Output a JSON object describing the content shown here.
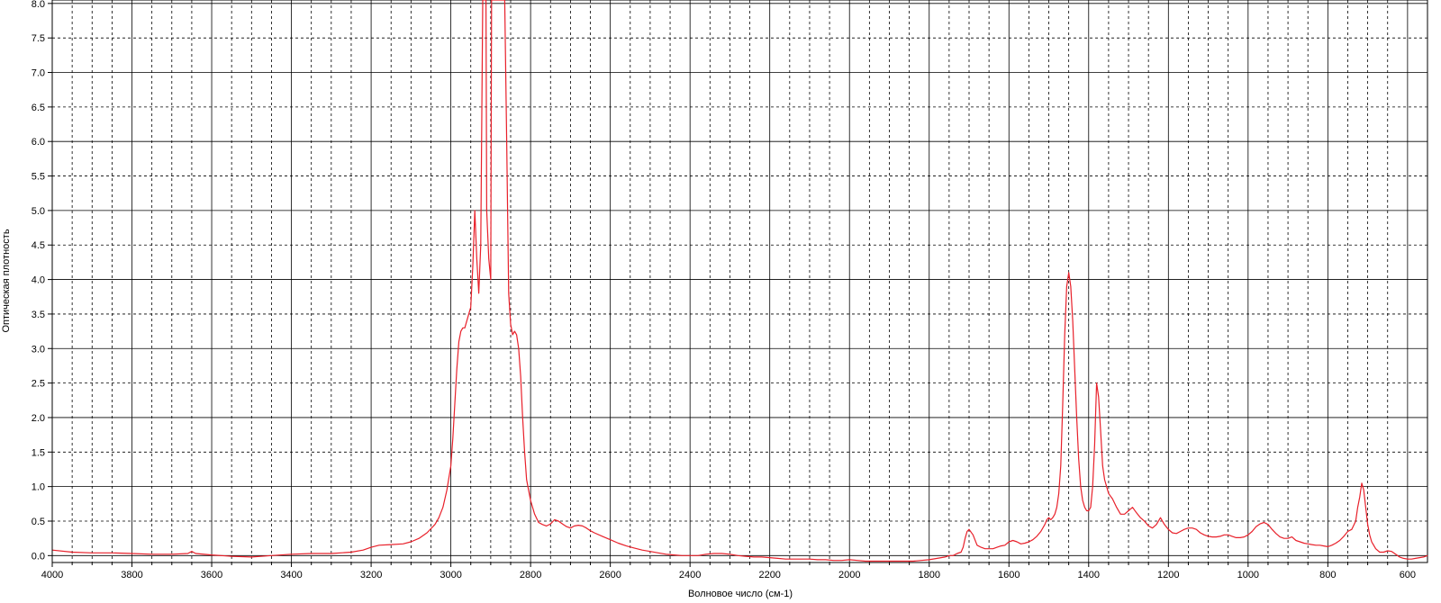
{
  "chart_data": {
    "type": "line",
    "xlabel": "Волновое число (см-1)",
    "ylabel": "Оптическая плотность",
    "xlim": [
      4000,
      550
    ],
    "ylim": [
      -0.1,
      8.05
    ],
    "x_reversed": true,
    "grid": true,
    "grid_major_x_step": 200,
    "grid_minor_x_step": 50,
    "grid_y_step": 0.5,
    "xticks": [
      4000,
      3800,
      3600,
      3400,
      3200,
      3000,
      2800,
      2600,
      2400,
      2200,
      2000,
      1800,
      1600,
      1400,
      1200,
      1000,
      800,
      600
    ],
    "xtick_labels": [
      "4000",
      "3800",
      "3600",
      "3400",
      "3200",
      "3000",
      "2800",
      "2600",
      "2400",
      "2200",
      "2000",
      "1800",
      "1600",
      "1400",
      "1200",
      "1000",
      "800",
      "600"
    ],
    "yticks": [
      0.0,
      0.5,
      1.0,
      1.5,
      2.0,
      2.5,
      3.0,
      3.5,
      4.0,
      4.5,
      5.0,
      5.5,
      6.0,
      6.5,
      7.0,
      7.5,
      8.0
    ],
    "ytick_labels": [
      "0.0",
      "0.5",
      "1.0",
      "1.5",
      "2.0",
      "2.5",
      "3.0",
      "3.5",
      "4.0",
      "4.5",
      "5.0",
      "5.5",
      "6.0",
      "6.5",
      "7.0",
      "7.5",
      "8.0"
    ],
    "colors": {
      "series": "#e8202a",
      "grid_major": "#000000",
      "grid_minor": "#000000",
      "axis": "#000000"
    },
    "series": [
      {
        "x": [
          4000,
          3950,
          3900,
          3850,
          3800,
          3750,
          3700,
          3660,
          3650,
          3640,
          3600,
          3550,
          3500,
          3450,
          3400,
          3350,
          3300,
          3250,
          3220,
          3200,
          3180,
          3150,
          3120,
          3100,
          3080,
          3060,
          3040,
          3030,
          3020,
          3010,
          3000,
          2995,
          2990,
          2985,
          2980,
          2975,
          2970,
          2965,
          2960,
          2955,
          2950,
          2945,
          2940,
          2935,
          2930,
          2925,
          2920,
          2915,
          2912,
          2910,
          2905,
          2900,
          2898,
          2895,
          2890,
          2880,
          2870,
          2865,
          2860,
          2855,
          2850,
          2845,
          2840,
          2835,
          2830,
          2825,
          2820,
          2815,
          2810,
          2800,
          2790,
          2780,
          2770,
          2760,
          2750,
          2740,
          2730,
          2720,
          2710,
          2700,
          2690,
          2680,
          2670,
          2660,
          2650,
          2640,
          2620,
          2600,
          2580,
          2560,
          2540,
          2520,
          2500,
          2480,
          2460,
          2440,
          2420,
          2400,
          2380,
          2360,
          2340,
          2320,
          2300,
          2280,
          2260,
          2240,
          2220,
          2200,
          2180,
          2160,
          2140,
          2120,
          2100,
          2080,
          2060,
          2040,
          2020,
          2000,
          1980,
          1960,
          1940,
          1920,
          1900,
          1880,
          1860,
          1840,
          1820,
          1800,
          1780,
          1760,
          1750,
          1740,
          1730,
          1720,
          1715,
          1710,
          1705,
          1700,
          1690,
          1680,
          1670,
          1660,
          1650,
          1640,
          1630,
          1620,
          1610,
          1600,
          1590,
          1580,
          1570,
          1560,
          1550,
          1540,
          1530,
          1520,
          1510,
          1505,
          1500,
          1495,
          1490,
          1485,
          1480,
          1475,
          1470,
          1465,
          1460,
          1455,
          1450,
          1445,
          1440,
          1435,
          1430,
          1425,
          1420,
          1415,
          1410,
          1405,
          1400,
          1395,
          1390,
          1385,
          1380,
          1375,
          1370,
          1365,
          1360,
          1355,
          1350,
          1340,
          1330,
          1320,
          1310,
          1300,
          1290,
          1280,
          1270,
          1260,
          1250,
          1240,
          1230,
          1220,
          1210,
          1200,
          1190,
          1180,
          1170,
          1160,
          1150,
          1140,
          1130,
          1120,
          1110,
          1100,
          1090,
          1080,
          1070,
          1060,
          1050,
          1040,
          1030,
          1020,
          1010,
          1000,
          990,
          980,
          970,
          960,
          950,
          940,
          930,
          920,
          910,
          900,
          890,
          880,
          870,
          860,
          850,
          840,
          830,
          820,
          810,
          800,
          790,
          780,
          770,
          760,
          750,
          740,
          730,
          725,
          720,
          715,
          710,
          705,
          700,
          695,
          690,
          680,
          670,
          660,
          650,
          640,
          630,
          620,
          610,
          600,
          590,
          580,
          570,
          560,
          550
        ],
        "y": [
          0.08,
          0.05,
          0.04,
          0.04,
          0.03,
          0.02,
          0.02,
          0.03,
          0.06,
          0.03,
          0.01,
          -0.01,
          -0.02,
          0.0,
          0.02,
          0.03,
          0.03,
          0.05,
          0.08,
          0.12,
          0.15,
          0.16,
          0.17,
          0.2,
          0.25,
          0.33,
          0.45,
          0.55,
          0.7,
          0.95,
          1.3,
          1.7,
          2.2,
          2.7,
          3.1,
          3.25,
          3.3,
          3.3,
          3.4,
          3.5,
          3.6,
          4.2,
          5.0,
          4.3,
          3.8,
          4.5,
          8.2,
          8.2,
          8.2,
          5.0,
          4.3,
          4.0,
          8.2,
          8.2,
          8.2,
          8.2,
          8.2,
          8.2,
          6.0,
          3.8,
          3.35,
          3.2,
          3.25,
          3.2,
          3.0,
          2.6,
          2.0,
          1.5,
          1.1,
          0.8,
          0.6,
          0.48,
          0.45,
          0.43,
          0.46,
          0.52,
          0.5,
          0.46,
          0.42,
          0.4,
          0.43,
          0.44,
          0.43,
          0.4,
          0.36,
          0.33,
          0.28,
          0.23,
          0.18,
          0.14,
          0.11,
          0.08,
          0.06,
          0.04,
          0.02,
          0.01,
          0.0,
          0.0,
          0.0,
          0.02,
          0.03,
          0.03,
          0.02,
          0.0,
          -0.01,
          -0.02,
          -0.02,
          -0.03,
          -0.04,
          -0.05,
          -0.05,
          -0.05,
          -0.05,
          -0.06,
          -0.06,
          -0.07,
          -0.07,
          -0.06,
          -0.07,
          -0.08,
          -0.08,
          -0.08,
          -0.08,
          -0.08,
          -0.08,
          -0.08,
          -0.07,
          -0.06,
          -0.04,
          -0.02,
          0.0,
          0.0,
          0.03,
          0.05,
          0.12,
          0.25,
          0.35,
          0.38,
          0.3,
          0.15,
          0.12,
          0.1,
          0.1,
          0.1,
          0.12,
          0.14,
          0.15,
          0.2,
          0.22,
          0.2,
          0.17,
          0.18,
          0.2,
          0.23,
          0.28,
          0.35,
          0.45,
          0.52,
          0.55,
          0.52,
          0.55,
          0.6,
          0.7,
          0.9,
          1.3,
          2.2,
          3.2,
          3.9,
          4.1,
          3.9,
          3.4,
          2.7,
          2.0,
          1.4,
          1.0,
          0.8,
          0.7,
          0.65,
          0.65,
          0.7,
          1.0,
          1.6,
          2.5,
          2.3,
          1.8,
          1.3,
          1.1,
          1.0,
          0.9,
          0.82,
          0.7,
          0.6,
          0.6,
          0.65,
          0.7,
          0.62,
          0.55,
          0.5,
          0.43,
          0.4,
          0.45,
          0.55,
          0.45,
          0.38,
          0.33,
          0.32,
          0.35,
          0.38,
          0.4,
          0.4,
          0.38,
          0.33,
          0.3,
          0.28,
          0.27,
          0.27,
          0.28,
          0.3,
          0.3,
          0.28,
          0.26,
          0.26,
          0.27,
          0.3,
          0.35,
          0.42,
          0.46,
          0.48,
          0.45,
          0.38,
          0.32,
          0.27,
          0.25,
          0.25,
          0.27,
          0.22,
          0.2,
          0.18,
          0.17,
          0.16,
          0.15,
          0.15,
          0.14,
          0.13,
          0.15,
          0.18,
          0.22,
          0.28,
          0.35,
          0.38,
          0.5,
          0.7,
          0.85,
          1.05,
          0.95,
          0.7,
          0.45,
          0.3,
          0.2,
          0.1,
          0.05,
          0.05,
          0.07,
          0.06,
          0.02,
          -0.02,
          -0.04,
          -0.05,
          -0.05,
          -0.04,
          -0.03,
          -0.02,
          0.0
        ]
      }
    ]
  }
}
